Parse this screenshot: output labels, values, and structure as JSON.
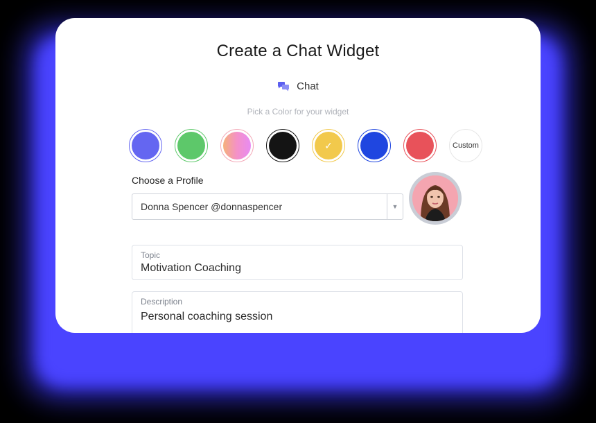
{
  "title": "Create a Chat Widget",
  "chat": {
    "label": "Chat",
    "icon": "chat-bubbles-icon",
    "icon_color": "#5b5ff0"
  },
  "color_picker": {
    "label": "Pick a Color for your widget",
    "swatches": [
      {
        "name": "blue-purple",
        "color": "#6466f1",
        "selected": false
      },
      {
        "name": "green",
        "color": "#5dc86a",
        "selected": false
      },
      {
        "name": "pink-gradient",
        "color": "#f59cc3",
        "selected": false
      },
      {
        "name": "black",
        "color": "#141414",
        "selected": false
      },
      {
        "name": "yellow",
        "color": "#f2c94c",
        "selected": true
      },
      {
        "name": "blue",
        "color": "#1f46e0",
        "selected": false
      },
      {
        "name": "red",
        "color": "#e8525a",
        "selected": false
      }
    ],
    "custom_label": "Custom"
  },
  "profile": {
    "label": "Choose a Profile",
    "selected": "Donna Spencer @donnaspencer"
  },
  "topic": {
    "label": "Topic",
    "value": "Motivation Coaching"
  },
  "description": {
    "label": "Description",
    "value": "Personal coaching session"
  }
}
